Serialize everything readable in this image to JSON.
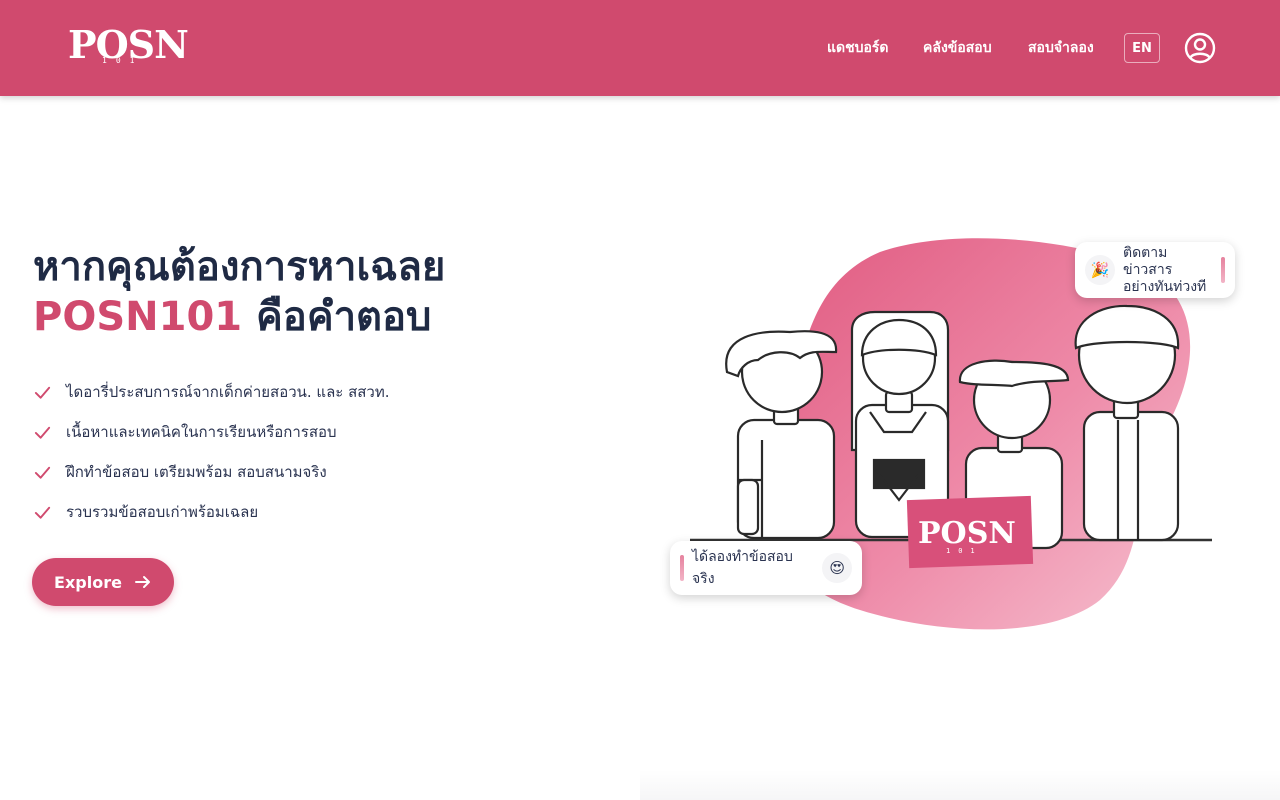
{
  "header": {
    "logo_text": "POSN",
    "logo_sub": "101",
    "nav": {
      "dashboard": "แดชบอร์ด",
      "bank": "คลังข้อสอบ",
      "mock": "สอบจำลอง"
    },
    "lang": "EN",
    "user_icon": "user-circle-icon"
  },
  "hero": {
    "headline_line1": "หากคุณต้องการหาเฉลย",
    "headline_accent": "POSN101",
    "headline_rest": " คือคำตอบ",
    "features": [
      "ไดอารี่ประสบการณ์จากเด็กค่ายสอวน. และ สสวท.",
      "เนื้อหาและเทคนิคในการเรียนหรือการสอบ",
      "ฝึกทำข้อสอบ เตรียมพร้อม สอบสนามจริง",
      "รวบรวมข้อสอบเก่าพร้อมเฉลย"
    ],
    "explore_label": "Explore"
  },
  "illustration": {
    "news_line1": "ติดตามข่าวสาร",
    "news_line2": "อย่างทันท่วงที",
    "exam_label": "ได้ลองทำข้อสอบจริง",
    "sign_text": "POSN",
    "sign_sub": "101"
  },
  "colors": {
    "brand": "#d04a6e",
    "heading": "#1f2a44",
    "blob": "#e96d8f"
  }
}
